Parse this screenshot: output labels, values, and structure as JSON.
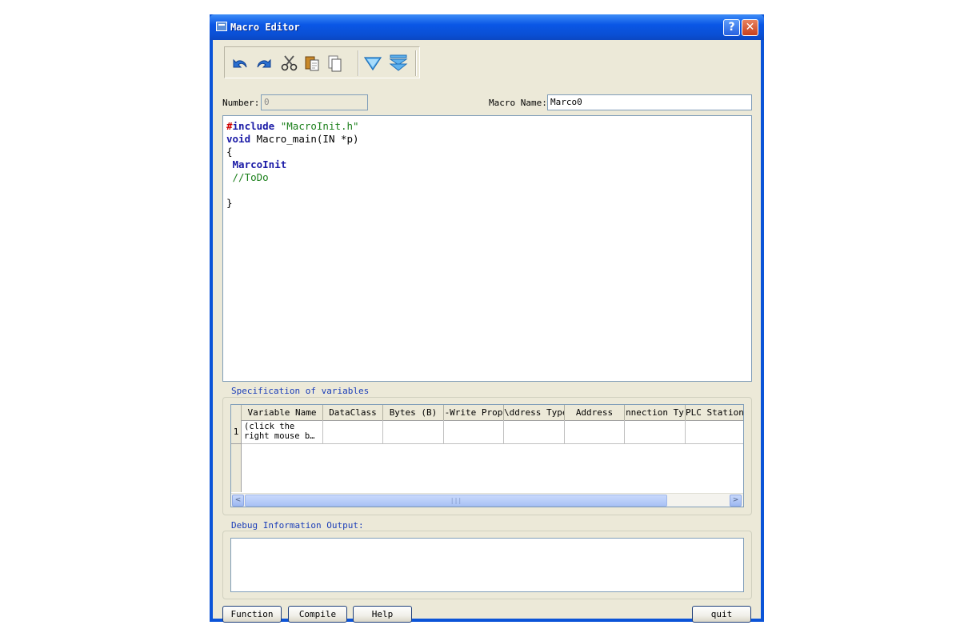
{
  "window": {
    "title": "Macro Editor"
  },
  "titlebar": {
    "help": "?",
    "close": "✕"
  },
  "toolbar": {
    "icons": [
      "undo-icon",
      "redo-icon",
      "cut-icon",
      "copy-icon",
      "paste-icon",
      "down-arrow-icon",
      "double-down-arrow-icon"
    ]
  },
  "form": {
    "number_label": "Number:",
    "number_value": "0",
    "macro_name_label": "Macro Name:",
    "macro_name_value": "Marco0"
  },
  "code": {
    "line1_hash": "#",
    "line1_kw": "include",
    "line1_str": "\"MacroInit.h\"",
    "line2_kw": "void",
    "line2_rest": " Macro_main(IN *p)",
    "line3": "{",
    "line4": "MarcoInit",
    "line5": "//ToDo",
    "line7": "}"
  },
  "variables": {
    "title": "Specification of variables",
    "columns": [
      "Variable Name",
      "DataClass",
      "Bytes (B)",
      "-Write Prop",
      "\\ddress Type",
      "Address",
      "nnection Ty",
      "PLC Station"
    ],
    "rows": [
      {
        "index": "1",
        "cells": [
          "(click the right mouse b…",
          "",
          "",
          "",
          "",
          "",
          "",
          ""
        ]
      }
    ],
    "scroll_left": "<",
    "scroll_right": ">",
    "scroll_grip": "|||"
  },
  "debug": {
    "title": "Debug Information Output:"
  },
  "buttons": {
    "function": "Function",
    "compile": "Compile",
    "help": "Help",
    "quit": "quit"
  }
}
